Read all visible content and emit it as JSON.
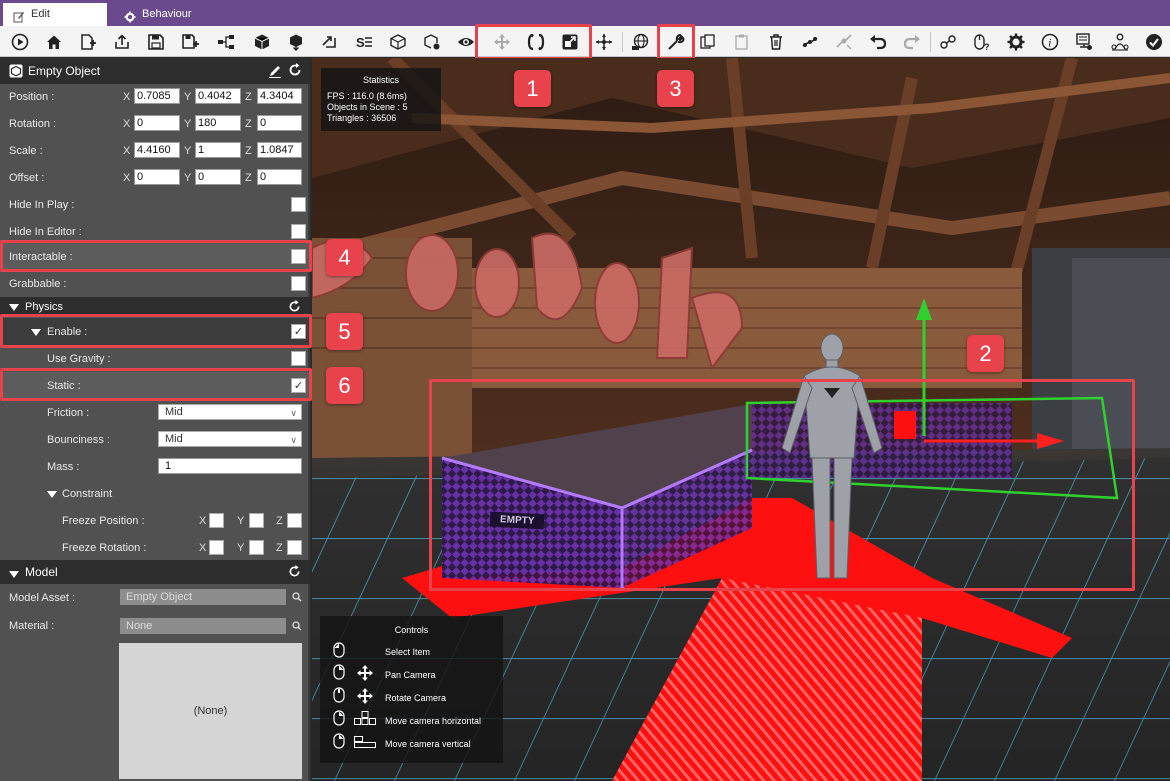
{
  "tabs": [
    {
      "label": "Edit",
      "icon": "edit-icon"
    },
    {
      "label": "Behaviour",
      "icon": "gear-icon"
    }
  ],
  "toolbar": {
    "tools": [
      "play-icon",
      "home-icon",
      "add-scene-icon",
      "export-icon",
      "save-icon",
      "save-plus-icon",
      "hierarchy-icon",
      "package-icon",
      "package-download-icon",
      "import-icon",
      "script-icon",
      "box-icon",
      "box-settings-icon",
      "eye-icon",
      "move-tool-icon",
      "rotate-tool-icon",
      "scale-tool-icon",
      "pivot-icon",
      "globe-icon",
      "wrench-icon",
      "copy-icon",
      "paste-icon",
      "delete-icon",
      "link-icon",
      "unlink-icon",
      "undo-icon",
      "redo-icon",
      "share-icon",
      "mouse-help-icon",
      "settings-icon",
      "info-icon",
      "monitor-icon",
      "network-icon",
      "account-icon"
    ]
  },
  "inspector": {
    "title": "Empty Object",
    "position": {
      "label": "Position :",
      "x": "0.7085",
      "y": "0.4042",
      "z": "4.3404"
    },
    "rotation": {
      "label": "Rotation :",
      "x": "0",
      "y": "180",
      "z": "0"
    },
    "scale": {
      "label": "Scale :",
      "x": "4.4160",
      "y": "1",
      "z": "1.0847"
    },
    "offset": {
      "label": "Offset :",
      "x": "0",
      "y": "0",
      "z": "0"
    },
    "hide_in_play": "Hide In Play :",
    "hide_in_editor": "Hide In Editor :",
    "interactable": "Interactable :",
    "grabbable": "Grabbable :",
    "physics": {
      "title": "Physics",
      "enable": "Enable :",
      "use_gravity": "Use Gravity :",
      "static": "Static :",
      "friction": {
        "label": "Friction :",
        "value": "Mid"
      },
      "bounciness": {
        "label": "Bounciness :",
        "value": "Mid"
      },
      "mass": {
        "label": "Mass :",
        "value": "1"
      },
      "constraint": "Constraint",
      "freeze_position": "Freeze Position :",
      "freeze_rotation": "Freeze Rotation :"
    },
    "model": {
      "title": "Model",
      "asset_label": "Model Asset :",
      "asset_value": "Empty Object",
      "material_label": "Material :",
      "material_value": "None",
      "preview": "(None)"
    },
    "axis": {
      "x": "X",
      "y": "Y",
      "z": "Z"
    },
    "checkmark": "✓"
  },
  "viewport": {
    "stats": {
      "title": "Statistics",
      "fps": "FPS : 116.0 (8.6ms)",
      "objects": "Objects in Scene : 5",
      "triangles": "Triangles : 36506"
    },
    "empty_label": "EMPTY",
    "controls": {
      "title": "Controls",
      "items": [
        "Select Item",
        "Pan Camera",
        "Rotate Camera",
        "Move camera horizontal",
        "Move camera vertical"
      ]
    }
  },
  "annotations": [
    "1",
    "2",
    "3",
    "4",
    "5",
    "6"
  ],
  "colors": {
    "accent": "#6a4a8c",
    "highlight": "#e8434d",
    "floor": "#ff1010",
    "gizmo_green": "#2fd12f",
    "checker": "#6a2fb0"
  }
}
